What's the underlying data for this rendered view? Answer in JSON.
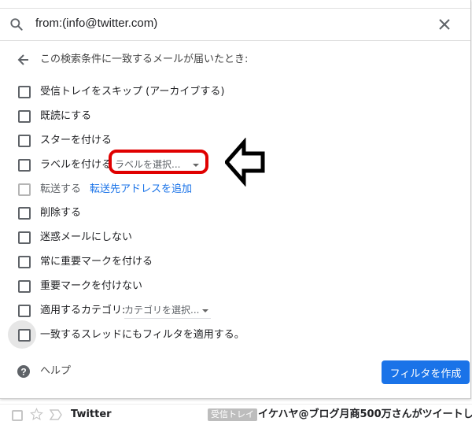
{
  "search": {
    "query": "from:(info@twitter.com)"
  },
  "header": {
    "back_text": "この検索条件に一致するメールが届いたとき:"
  },
  "options": [
    {
      "label": "受信トレイをスキップ (アーカイブする)"
    },
    {
      "label": "既読にする"
    },
    {
      "label": "スターを付ける"
    },
    {
      "label": "ラベルを付ける",
      "select": "ラベルを選択..."
    },
    {
      "label": "転送する",
      "link": "転送先アドレスを追加"
    },
    {
      "label": "削除する"
    },
    {
      "label": "迷惑メールにしない"
    },
    {
      "label": "常に重要マークを付ける"
    },
    {
      "label": "重要マークを付けない"
    },
    {
      "label": "適用するカテゴリ:",
      "select": "カテゴリを選択..."
    },
    {
      "label": "一致するスレッドにもフィルタを適用する。"
    }
  ],
  "footer": {
    "help": "ヘルプ",
    "create_button": "フィルタを作成"
  },
  "mail": {
    "sender": "Twitter",
    "badge": "受信トレイ",
    "subject": "イケハヤ@ブログ月商500万さんがツイートしまし"
  },
  "colors": {
    "primary": "#1a73e8",
    "highlight": "#e00000",
    "arrow": "#000000"
  },
  "icons": [
    "search-icon",
    "close-icon",
    "back-arrow-icon",
    "help-icon",
    "star-icon",
    "important-icon",
    "left-arrow-icon"
  ]
}
